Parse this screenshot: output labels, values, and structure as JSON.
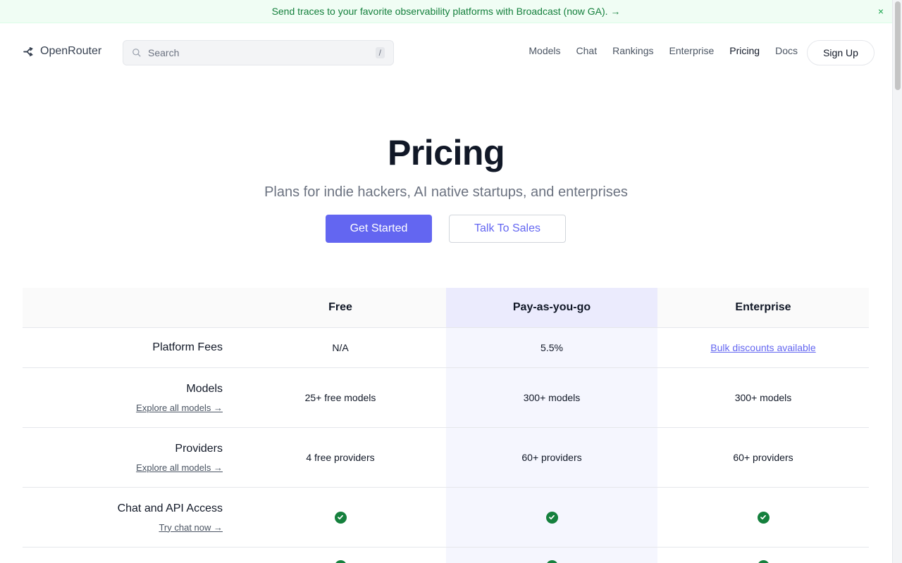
{
  "banner": {
    "text": "Send traces to your favorite observability platforms with Broadcast (now GA). →",
    "close": "×"
  },
  "nav": {
    "brand": "OpenRouter",
    "search_placeholder": "Search",
    "search_shortcut": "/",
    "links": [
      "Models",
      "Chat",
      "Rankings",
      "Enterprise",
      "Pricing",
      "Docs"
    ],
    "active_link": "Pricing",
    "signup": "Sign Up"
  },
  "hero": {
    "title": "Pricing",
    "subtitle": "Plans for indie hackers, AI native startups, and enterprises",
    "primary_button": "Get Started",
    "secondary_button": "Talk To Sales"
  },
  "pricing_table": {
    "plans": [
      "Free",
      "Pay-as-you-go",
      "Enterprise"
    ],
    "rows": [
      {
        "label": "Platform Fees",
        "values": [
          "N/A",
          "5.5%",
          "Bulk discounts available"
        ]
      },
      {
        "label": "Models",
        "link": "Explore all models →",
        "values": [
          "25+ free models",
          "300+ models",
          "300+ models"
        ]
      },
      {
        "label": "Providers",
        "link": "Explore all models →",
        "values": [
          "4 free providers",
          "60+ providers",
          "60+ providers"
        ]
      },
      {
        "label": "Chat and API Access",
        "link": "Try chat now →",
        "values": [
          "check",
          "check",
          "check"
        ]
      }
    ]
  },
  "colors": {
    "accent": "#6366f1",
    "check": "#15803d",
    "banner_text": "#15803d"
  }
}
